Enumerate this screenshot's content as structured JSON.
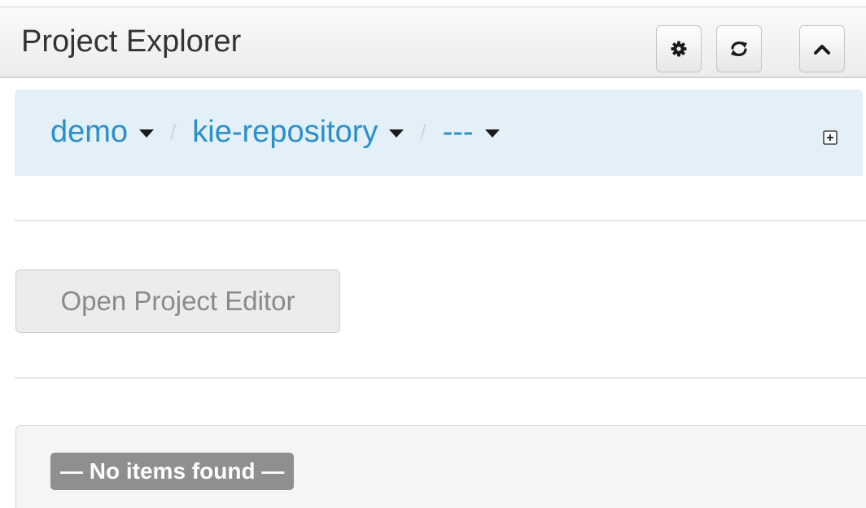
{
  "header": {
    "title": "Project Explorer",
    "buttons": {
      "settings_icon": "gear-icon",
      "refresh_icon": "refresh-icon",
      "collapse_icon": "chevron-up-icon"
    }
  },
  "breadcrumb": {
    "organizational_unit": "demo",
    "repository": "kie-repository",
    "project": "---",
    "separator": "/",
    "expand_icon": "plus-square-icon"
  },
  "actions": {
    "open_project_editor": "Open Project Editor"
  },
  "list": {
    "empty_message": "— No items found —"
  },
  "colors": {
    "link": "#2a8fcf",
    "breadcrumb_bg": "#e3f0f8",
    "badge_bg": "#8f8f8f"
  }
}
